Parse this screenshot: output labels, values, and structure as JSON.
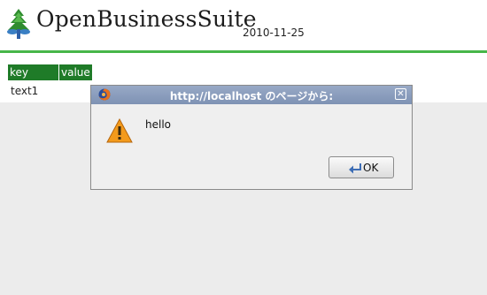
{
  "header": {
    "logo_icon": "tree-logo-icon",
    "logo_text": "OpenBusinessSuite",
    "date": "2010-11-25",
    "accent_color": "#47b649"
  },
  "table": {
    "columns": [
      "key",
      "value"
    ],
    "rows": [
      {
        "key": "text1",
        "value": ""
      }
    ],
    "header_color": "#1f7b28"
  },
  "dialog": {
    "app_icon": "firefox-icon",
    "title": "http://localhost のページから:",
    "close_icon": "close-icon",
    "message_icon": "warning-icon",
    "message": "hello",
    "ok_icon": "ok-arrow-icon",
    "ok_label": "OK"
  }
}
